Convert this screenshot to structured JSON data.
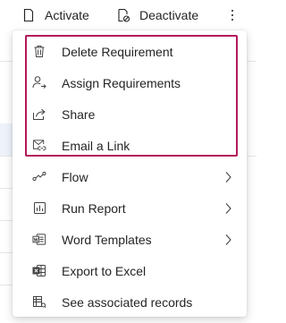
{
  "command_bar": {
    "activate_label": "Activate",
    "deactivate_label": "Deactivate",
    "more_icon": "more-vertical-icon"
  },
  "menu": {
    "highlight_color": "#b4185a",
    "items": [
      {
        "label": "Delete Requirement",
        "icon": "trash-icon",
        "submenu": false
      },
      {
        "label": "Assign Requirements",
        "icon": "person-arrow-icon",
        "submenu": false
      },
      {
        "label": "Share",
        "icon": "share-icon",
        "submenu": false
      },
      {
        "label": "Email a Link",
        "icon": "mail-link-icon",
        "submenu": false
      },
      {
        "label": "Flow",
        "icon": "flow-icon",
        "submenu": true
      },
      {
        "label": "Run Report",
        "icon": "report-icon",
        "submenu": true
      },
      {
        "label": "Word Templates",
        "icon": "word-icon",
        "submenu": true
      },
      {
        "label": "Export to Excel",
        "icon": "excel-icon",
        "submenu": false
      },
      {
        "label": "See associated records",
        "icon": "associated-records-icon",
        "submenu": false
      }
    ]
  }
}
